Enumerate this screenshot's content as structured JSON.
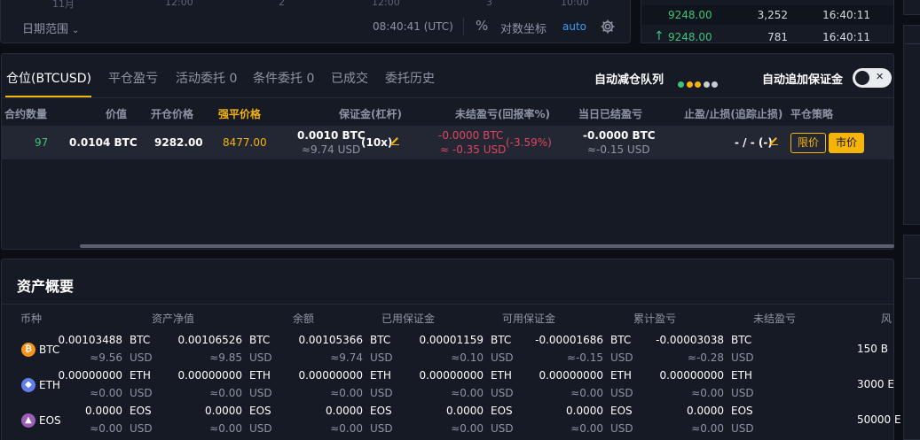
{
  "chart": {
    "axis_labels": [
      "11月",
      "12:00",
      "2",
      "12:00",
      "3",
      "10:00"
    ],
    "range_label": "日期范围",
    "time": "08:40:41 (UTC)",
    "percent_label": "%",
    "log_label": "对数坐标",
    "auto_label": "auto"
  },
  "trades": [
    {
      "price": "9248.00",
      "qty": "3,252",
      "time": "16:40:11",
      "side": "buy"
    },
    {
      "price": "9248.00",
      "qty": "781",
      "time": "16:40:11",
      "side": "buy"
    }
  ],
  "positions": {
    "tabs": [
      "仓位(BTCUSD)",
      "平仓盈亏",
      "活动委托 0",
      "条件委托 0",
      "已成交",
      "委托历史"
    ],
    "adl_label": "自动减仓队列",
    "adl_dots": [
      "#3ec37a",
      "#f5b40a",
      "#f5b40a",
      "#c9ccd2",
      "#c9ccd2"
    ],
    "auto_margin_label": "自动追加保证金",
    "auto_margin_on": false,
    "headers": {
      "qty": "合约数量",
      "value": "价值",
      "entry": "开仓价格",
      "liq": "强平价格",
      "margin": "保证金(杠杆)",
      "unrealized": "未结盈亏(回报率%)",
      "daily_realized": "当日已结盈亏",
      "tp_sl": "止盈/止损(追踪止损)",
      "close": "平仓策略"
    },
    "row": {
      "qty": "97",
      "value": "0.0104 BTC",
      "entry": "9282.00",
      "liq": "8477.00",
      "margin_btc": "0.0010 BTC",
      "margin_usd": "≈9.74 USD",
      "leverage": "(10x)",
      "unrealized_btc": "-0.0000 BTC",
      "unrealized_usd": "≈ -0.35 USD",
      "roe": "(-3.59%)",
      "daily_btc": "-0.0000 BTC",
      "daily_usd": "≈-0.15 USD",
      "tp_sl": "- / - (-)",
      "limit_btn": "限价",
      "market_btn": "市价"
    }
  },
  "assets": {
    "title": "资产概要",
    "headers": [
      "币种",
      "资产净值",
      "余额",
      "已用保证金",
      "可用保证金",
      "累计盈亏",
      "未结盈亏",
      "风"
    ],
    "rows": [
      {
        "coin": "BTC",
        "icon": "bitcoin-icon",
        "color": "#f7931a",
        "glyph": "₿",
        "equity": "0.00103488",
        "equity_usd": "≈9.56",
        "balance": "0.00106526",
        "balance_usd": "≈9.85",
        "used": "0.00105366",
        "used_usd": "≈9.74",
        "avail": "0.00001159",
        "avail_usd": "≈0.10",
        "cum": "-0.00001686",
        "cum_usd": "≈-0.15",
        "unr": "-0.00003038",
        "unr_usd": "≈-0.28",
        "risk": "150 B"
      },
      {
        "coin": "ETH",
        "icon": "ethereum-icon",
        "color": "#627eea",
        "glyph": "◆",
        "equity": "0.00000000",
        "equity_usd": "≈0.00",
        "balance": "0.00000000",
        "balance_usd": "≈0.00",
        "used": "0.00000000",
        "used_usd": "≈0.00",
        "avail": "0.00000000",
        "avail_usd": "≈0.00",
        "cum": "0.00000000",
        "cum_usd": "≈0.00",
        "unr": "0.00000000",
        "unr_usd": "≈0.00",
        "risk": "3000 E"
      },
      {
        "coin": "EOS",
        "icon": "eos-icon",
        "color": "#9b5fb8",
        "glyph": "▲",
        "equity": "0.0000",
        "equity_usd": "≈0.00",
        "balance": "0.0000",
        "balance_usd": "≈0.00",
        "used": "0.0000",
        "used_usd": "≈0.00",
        "avail": "0.0000",
        "avail_usd": "≈0.00",
        "cum": "0.0000",
        "cum_usd": "≈0.00",
        "unr": "0.0000",
        "unr_usd": "≈0.00",
        "risk": "50000 E"
      }
    ],
    "unit_usd": "USD"
  }
}
